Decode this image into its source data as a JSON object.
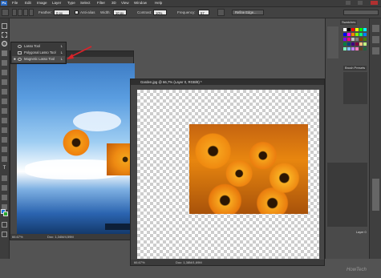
{
  "app": {
    "logo": "Ps"
  },
  "menubar": {
    "items": [
      "File",
      "Edit",
      "Image",
      "Layer",
      "Type",
      "Select",
      "Filter",
      "3D",
      "View",
      "Window",
      "Help"
    ]
  },
  "options": {
    "feather_label": "Feather:",
    "feather_value": "0 px",
    "antialias_label": "Anti-alias",
    "width_label": "Width:",
    "width_value": "10 px",
    "contrast_label": "Contrast:",
    "contrast_value": "10%",
    "frequency_label": "Frequency:",
    "frequency_value": "57",
    "refine_edge": "Refine Edge..."
  },
  "flyout": {
    "items": [
      {
        "label": "Lasso Tool",
        "key": "L",
        "active": false
      },
      {
        "label": "Polygonal Lasso Tool",
        "key": "L",
        "active": false
      },
      {
        "label": "Magnetic Lasso Tool",
        "key": "L",
        "active": true
      }
    ]
  },
  "doc_back": {
    "zoom": "66.67%",
    "info": "Doc: 1,34M/4,59M"
  },
  "doc_front": {
    "title": "Garden.jpg @ 66,7% (Layer 0, RGB/8) *",
    "zoom": "66.67%",
    "info": "Doc: 1,38M/1,69M"
  },
  "panels": {
    "swatches_tab": "Swatches",
    "brush_tab": "Brush Presets",
    "layer_label": "Layer 0"
  },
  "colors": {
    "accent": "#2a6ac3",
    "arrow": "#d8232a",
    "swatches": [
      "#ffffff",
      "#000000",
      "#ff0000",
      "#ffff00",
      "#00ff00",
      "#00ffff",
      "#0000ff",
      "#ff00ff",
      "#ff8000",
      "#80ff00",
      "#00ff80",
      "#0080ff",
      "#8000ff",
      "#ff0080",
      "#c0c0c0",
      "#808080",
      "#804000",
      "#408000",
      "#008040",
      "#004080",
      "#400080",
      "#800040",
      "#ffc080",
      "#c0ff80",
      "#80ffc0",
      "#80c0ff",
      "#c080ff",
      "#ff80c0",
      "#604020",
      "#206040"
    ]
  },
  "watermark": "HowTech"
}
